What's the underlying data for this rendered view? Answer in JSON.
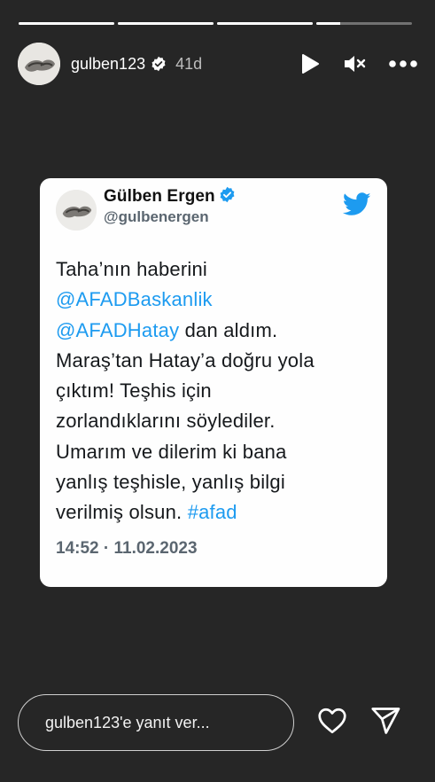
{
  "story": {
    "progress": [
      1,
      1,
      1,
      0.25
    ],
    "user": {
      "username": "gulben123",
      "verified": true,
      "time_ago": "41d"
    },
    "controls": {
      "play_icon": "play-icon",
      "mute_icon": "mute-icon",
      "more_icon": "more-icon"
    }
  },
  "tweet": {
    "display_name": "Gülben Ergen",
    "handle": "@gulbenergen",
    "body": {
      "line1": "Taha’nın haberini",
      "mention1": "@AFADBaskanlik",
      "mention2": "@AFADHatay",
      "line3_rest": " dan aldım.",
      "line4": "Maraş’tan Hatay’a doğru yola",
      "line5": "çıktım! Teşhis için",
      "line6": "zorlandıklarını söylediler.",
      "line7": "Umarım ve dilerim ki bana",
      "line8": "yanlış teşhisle, yanlış bilgi",
      "line9_pre": "verilmiş olsun. ",
      "hashtag": "#afad"
    },
    "timestamp": "14:52 · 11.02.2023",
    "colors": {
      "link": "#1d9bf0",
      "verified": "#1d9bf0",
      "bird": "#1d9bf0"
    }
  },
  "footer": {
    "reply_placeholder": "gulben123'e yanıt ver...",
    "like_icon": "heart-icon",
    "share_icon": "send-icon"
  }
}
